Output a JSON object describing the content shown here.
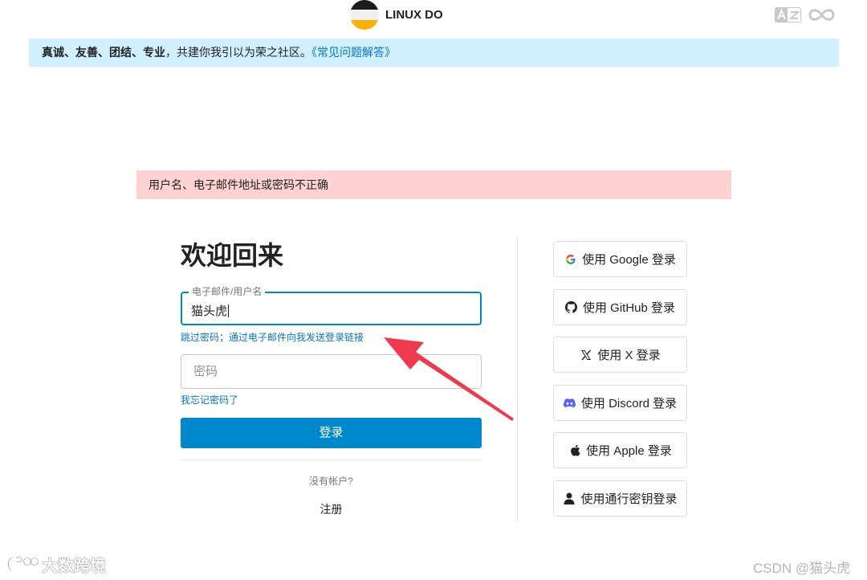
{
  "header": {
    "site_title": "LINUX DO",
    "logo_colors": [
      "#1c1c1e",
      "#f0f0f0",
      "#ffb003"
    ],
    "icons": [
      "translate-icon",
      "infinity-icon"
    ]
  },
  "banner": {
    "text_bold": "真诚、友善、团结、专业",
    "text_rest": "，共建你我引以为荣之社区。",
    "link_text": "《常见问题解答》",
    "background": "#d1f0ff"
  },
  "alert": {
    "text": "用户名、电子邮件地址或密码不正确",
    "background": "#ffd1d1"
  },
  "login": {
    "title": "欢迎回来",
    "email_label": "电子邮件/用户名",
    "email_value": "猫头虎",
    "skip_password_link": "跳过密码；通过电子邮件向我发送登录链接",
    "password_placeholder": "密码",
    "forgot_link": "我忘记密码了",
    "login_button": "登录",
    "no_account_text": "没有帐户?",
    "signup_link": "注册",
    "accent": "#0088cc"
  },
  "social": [
    {
      "label": "使用 Google 登录",
      "icon": "google-icon"
    },
    {
      "label": "使用 GitHub 登录",
      "icon": "github-icon"
    },
    {
      "label": "使用 X 登录",
      "icon": "x-icon"
    },
    {
      "label": "使用 Discord 登录",
      "icon": "discord-icon"
    },
    {
      "label": "使用 Apple 登录",
      "icon": "apple-icon"
    },
    {
      "label": "使用通行密钥登录",
      "icon": "user-icon"
    }
  ],
  "annotation": {
    "arrow_color": "#ee3a4c"
  },
  "watermarks": {
    "left": "大数跨境",
    "right": "CSDN @猫头虎"
  }
}
